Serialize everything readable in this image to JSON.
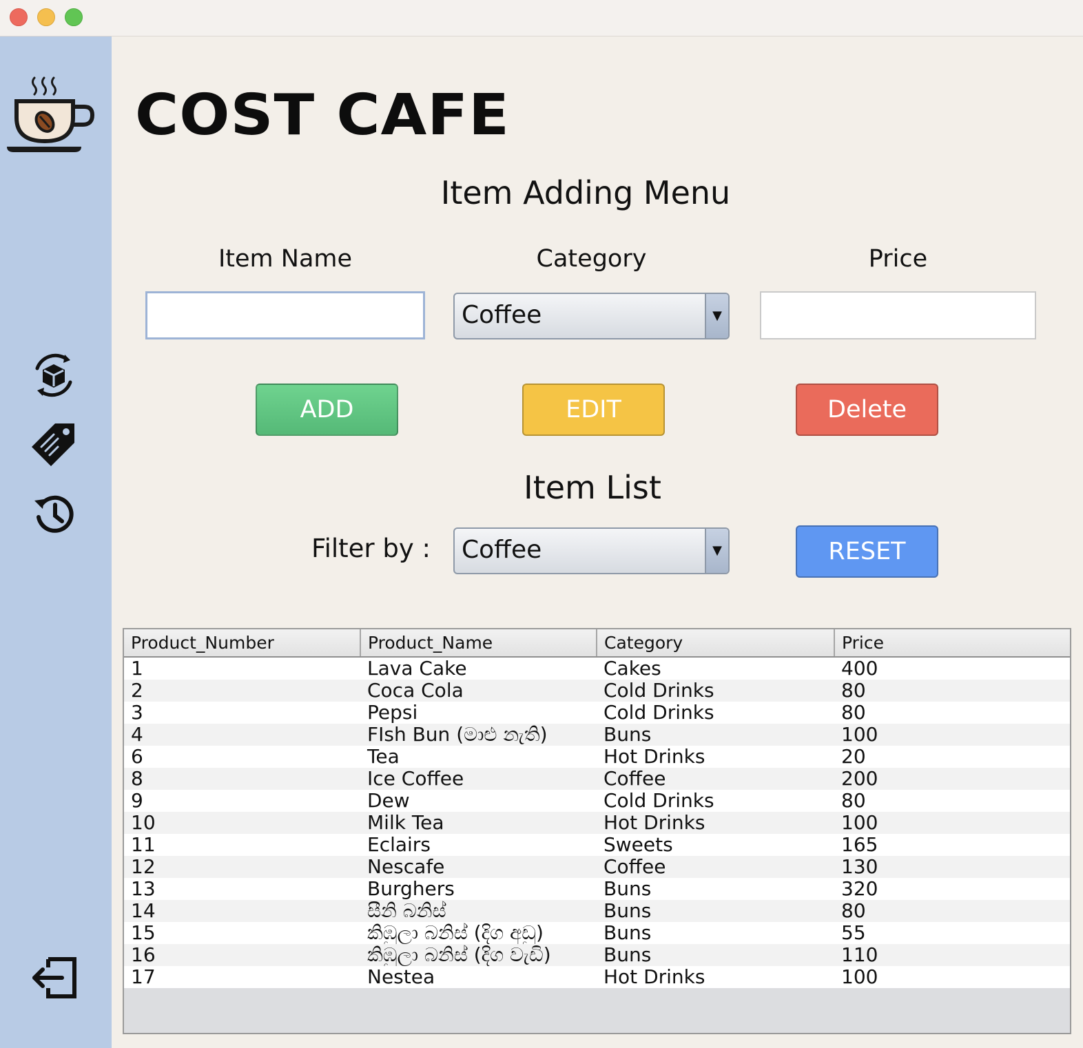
{
  "app": {
    "brand": "COST CAFE"
  },
  "sidebar": {
    "logo": "coffee-cup-icon",
    "items": [
      {
        "icon": "product-box-icon"
      },
      {
        "icon": "price-tag-icon"
      },
      {
        "icon": "history-icon"
      }
    ],
    "logout": {
      "icon": "logout-icon"
    }
  },
  "form": {
    "title": "Item Adding Menu",
    "item_name_label": "Item Name",
    "item_name_value": "",
    "category_label": "Category",
    "category_value": "Coffee",
    "price_label": "Price",
    "price_value": "",
    "add_label": "ADD",
    "edit_label": "EDIT",
    "delete_label": "Delete"
  },
  "list": {
    "title": "Item List",
    "filter_label": "Filter by :",
    "filter_value": "Coffee",
    "reset_label": "RESET"
  },
  "table": {
    "columns": [
      "Product_Number",
      "Product_Name",
      "Category",
      "Price"
    ],
    "rows": [
      [
        "1",
        "Lava Cake",
        "Cakes",
        "400"
      ],
      [
        "2",
        "Coca Cola",
        "Cold Drinks",
        "80"
      ],
      [
        "3",
        "Pepsi",
        "Cold Drinks",
        "80"
      ],
      [
        "4",
        "FIsh Bun (මාළු නැති)",
        "Buns",
        "100"
      ],
      [
        "6",
        "Tea",
        "Hot Drinks",
        "20"
      ],
      [
        "8",
        "Ice Coffee",
        "Coffee",
        "200"
      ],
      [
        "9",
        "Dew",
        "Cold Drinks",
        "80"
      ],
      [
        "10",
        "Milk Tea",
        "Hot Drinks",
        "100"
      ],
      [
        "11",
        "Eclairs",
        "Sweets",
        "165"
      ],
      [
        "12",
        "Nescafe",
        "Coffee",
        "130"
      ],
      [
        "13",
        "Burghers",
        "Buns",
        "320"
      ],
      [
        "14",
        "සීනි බනිස්",
        "Buns",
        "80"
      ],
      [
        "15",
        "කිඹුලා බනිස් (දිග අඩු)",
        "Buns",
        "55"
      ],
      [
        "16",
        "කිඹුලා බනිස් (දිග වැඩි)",
        "Buns",
        "110"
      ],
      [
        "17",
        "Nestea",
        "Hot Drinks",
        "100"
      ]
    ]
  },
  "colors": {
    "sidebar": "#b8cbe5",
    "background": "#f3efe9",
    "add": "#5fc47f",
    "edit": "#f5c445",
    "delete": "#ea6b5b",
    "reset": "#5f97f2"
  }
}
